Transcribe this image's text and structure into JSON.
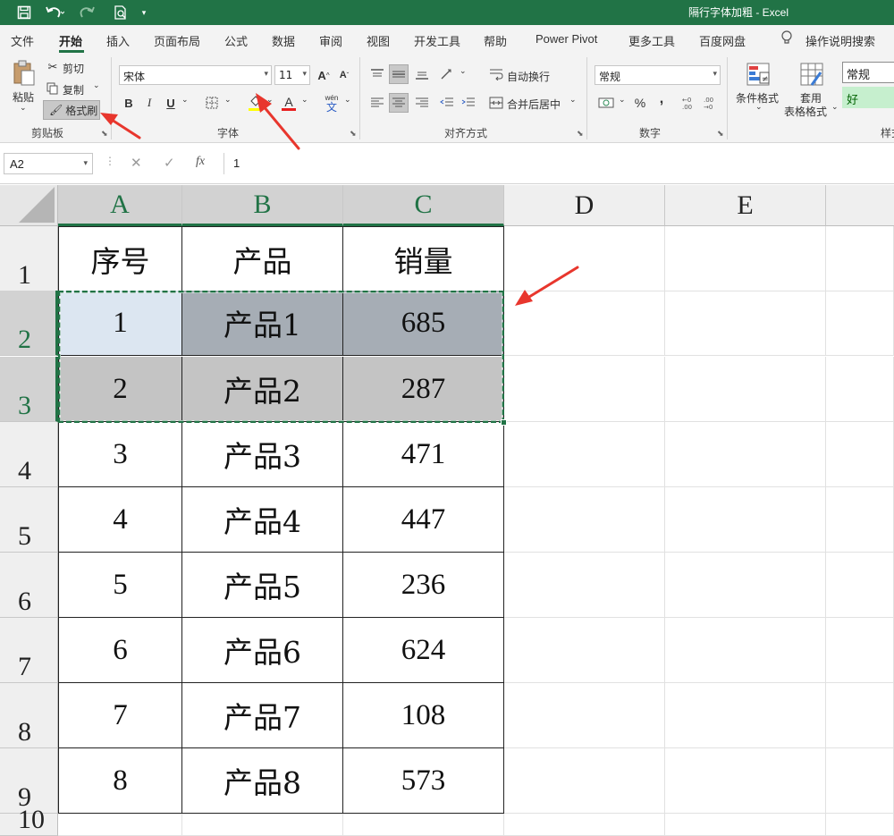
{
  "window": {
    "title": "隔行字体加粗  -  Excel",
    "quick_access": [
      "save-icon",
      "undo-icon",
      "redo-icon",
      "print-preview-icon",
      "customize-icon"
    ]
  },
  "menu_tabs": [
    {
      "label": "文件"
    },
    {
      "label": "开始",
      "active": true
    },
    {
      "label": "插入"
    },
    {
      "label": "页面布局"
    },
    {
      "label": "公式"
    },
    {
      "label": "数据"
    },
    {
      "label": "审阅"
    },
    {
      "label": "视图"
    },
    {
      "label": "开发工具"
    },
    {
      "label": "帮助"
    },
    {
      "label": "Power Pivot"
    },
    {
      "label": "更多工具"
    },
    {
      "label": "百度网盘"
    },
    {
      "label": "操作说明搜索"
    }
  ],
  "ribbon": {
    "clipboard": {
      "paste": "粘贴",
      "cut": "剪切",
      "copy": "复制",
      "format_painter": "格式刷",
      "group": "剪贴板"
    },
    "font": {
      "name": "宋体",
      "size": "11",
      "bold": "B",
      "italic": "I",
      "underline": "U",
      "wen": "wén",
      "wen2": "文",
      "grow": "A",
      "shrink": "A",
      "color_glyph": "A",
      "group": "字体"
    },
    "alignment": {
      "wrap": "自动换行",
      "merge": "合并后居中",
      "group": "对齐方式"
    },
    "number": {
      "format": "常规",
      "percent": "%",
      "comma": ",",
      "group": "数字"
    },
    "styles": {
      "conditional": "条件格式",
      "table_format_1": "套用",
      "table_format_2": "表格格式",
      "style_normal": "常规",
      "style_good": "好",
      "group": "样式"
    }
  },
  "formula_bar": {
    "name_box": "A2",
    "cancel": "✕",
    "enter": "✓",
    "fx": "fx",
    "value": "1"
  },
  "sheet": {
    "columns": [
      "A",
      "B",
      "C",
      "D",
      "E"
    ],
    "rows": [
      "1",
      "2",
      "3",
      "4",
      "5",
      "6",
      "7",
      "8",
      "9",
      "10"
    ],
    "header": [
      "序号",
      "产品",
      "销量"
    ],
    "data": [
      [
        "1",
        "产品1",
        "685"
      ],
      [
        "2",
        "产品2",
        "287"
      ],
      [
        "3",
        "产品3",
        "471"
      ],
      [
        "4",
        "产品4",
        "447"
      ],
      [
        "5",
        "产品5",
        "236"
      ],
      [
        "6",
        "产品6",
        "624"
      ],
      [
        "7",
        "产品7",
        "108"
      ],
      [
        "8",
        "产品8",
        "573"
      ]
    ]
  },
  "colors": {
    "accent": "#217346",
    "annotation": "#e8362d",
    "row2_fill": "#a6adb5",
    "row2_active": "#dce6f1",
    "row3_fill": "#c4c4c4"
  }
}
